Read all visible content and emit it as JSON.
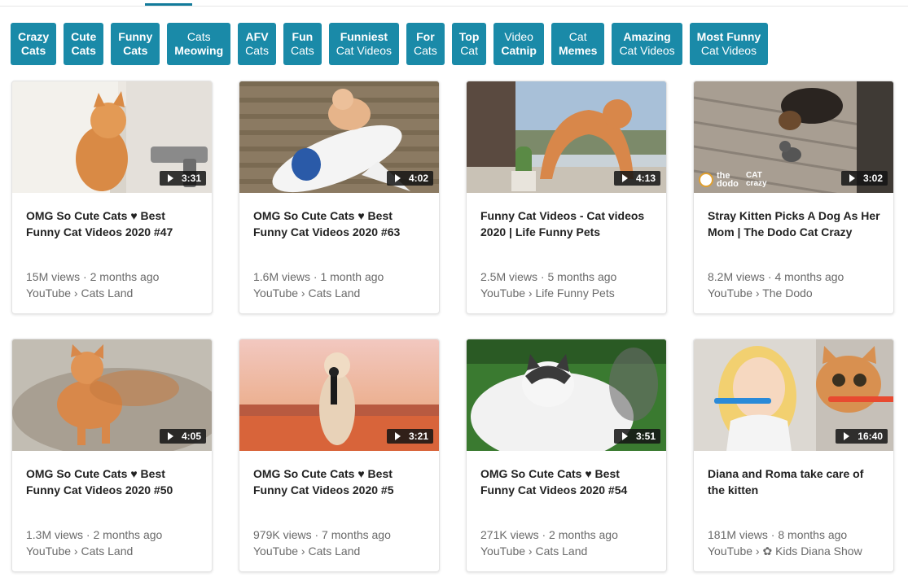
{
  "accent_color": "#1a8aa8",
  "chips": [
    {
      "line1": "Crazy",
      "line2": "Cats"
    },
    {
      "line1": "Cute",
      "line2": "Cats"
    },
    {
      "line1": "Funny",
      "line2": "Cats"
    },
    {
      "line1": "Cats",
      "line2": "Meowing"
    },
    {
      "line1": "AFV",
      "line2": "Cats"
    },
    {
      "line1": "Fun",
      "line2": "Cats"
    },
    {
      "line1": "Funniest",
      "line2": "Cat Videos"
    },
    {
      "line1": "For",
      "line2": "Cats"
    },
    {
      "line1": "Top",
      "line2": "Cat"
    },
    {
      "line1": "Video",
      "line2": "Catnip"
    },
    {
      "line1": "Cat",
      "line2": "Memes"
    },
    {
      "line1": "Amazing",
      "line2": "Cat Videos"
    },
    {
      "line1": "Most Funny",
      "line2": "Cat Videos"
    }
  ],
  "videos": [
    {
      "duration": "3:31",
      "title": "OMG So Cute Cats ♥ Best Funny Cat Videos 2020 #47",
      "views": "15M views · 2 months ago",
      "source": "YouTube › Cats Land"
    },
    {
      "duration": "4:02",
      "title": "OMG So Cute Cats ♥ Best Funny Cat Videos 2020 #63",
      "views": "1.6M views · 1 month ago",
      "source": "YouTube › Cats Land"
    },
    {
      "duration": "4:13",
      "title": "Funny Cat Videos - Cat videos 2020 | Life Funny Pets",
      "views": "2.5M views · 5 months ago",
      "source": "YouTube › Life Funny Pets"
    },
    {
      "duration": "3:02",
      "title": "Stray Kitten Picks A Dog As Her Mom | The Dodo Cat Crazy",
      "views": "8.2M views · 4 months ago",
      "source": "YouTube › The Dodo",
      "watermark1": "the dodo",
      "watermark2": "CAT crazy"
    },
    {
      "duration": "4:05",
      "title": "OMG So Cute Cats ♥ Best Funny Cat Videos 2020 #50",
      "views": "1.3M views · 2 months ago",
      "source": "YouTube › Cats Land"
    },
    {
      "duration": "3:21",
      "title": "OMG So Cute Cats ♥ Best Funny Cat Videos 2020 #5",
      "views": "979K views · 7 months ago",
      "source": "YouTube › Cats Land"
    },
    {
      "duration": "3:51",
      "title": "OMG So Cute Cats ♥ Best Funny Cat Videos 2020 #54",
      "views": "271K views · 2 months ago",
      "source": "YouTube › Cats Land"
    },
    {
      "duration": "16:40",
      "title": "Diana and Roma take care of the kitten",
      "views": "181M views · 8 months ago",
      "source": "YouTube › ✿ Kids Diana Show"
    }
  ]
}
